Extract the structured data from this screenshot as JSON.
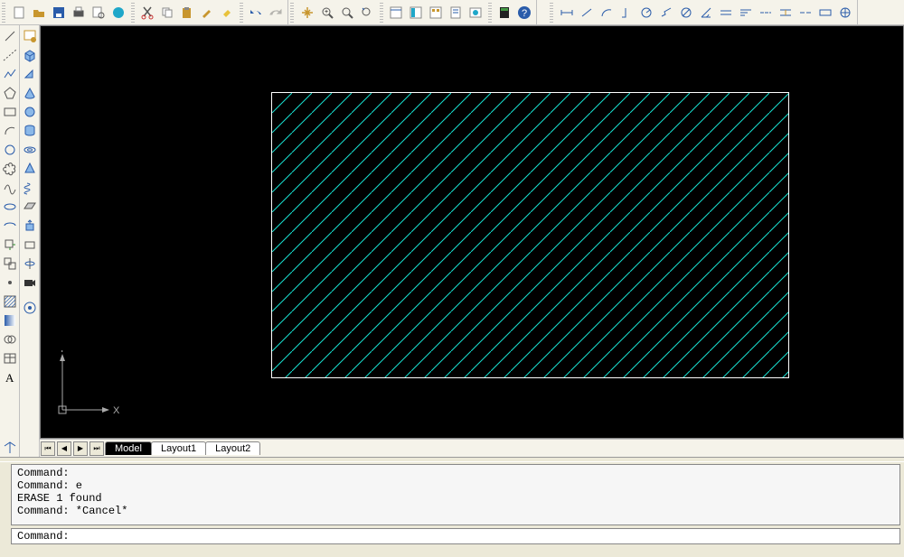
{
  "toolbar": {
    "group1": [
      "new",
      "open",
      "save",
      "print",
      "print-preview",
      "publish",
      "cut",
      "copy",
      "paste",
      "match",
      "paint",
      "undo",
      "redo"
    ],
    "group2": [
      "pan",
      "zoom-realtime",
      "zoom-window",
      "zoom-previous",
      "properties",
      "design-center",
      "tool-palettes",
      "sheet-set",
      "markup",
      "calc",
      "help"
    ],
    "group3": [
      "dim-linear",
      "dim-aligned",
      "dim-arc",
      "dim-ordinate",
      "dim-radius",
      "dim-jogged",
      "dim-diameter",
      "dim-angular",
      "dim-quick",
      "dim-baseline",
      "dim-continue",
      "dim-space",
      "dim-break",
      "dim-tolerance",
      "dim-center"
    ]
  },
  "left_tools_a": [
    "line",
    "construction-line",
    "polyline",
    "polygon",
    "rectangle",
    "arc",
    "circle",
    "revision-cloud",
    "spline",
    "ellipse",
    "ellipse-arc",
    "insert-block",
    "make-block",
    "point",
    "hatch",
    "gradient",
    "region",
    "table",
    "text"
  ],
  "left_tools_b": [
    "workspace-icon",
    "box",
    "wedge",
    "cone",
    "sphere",
    "cylinder",
    "torus",
    "pyramid",
    "helix",
    "planar-surface",
    "extrude",
    "revolve",
    "camera"
  ],
  "tabs": {
    "nav": [
      "⏮",
      "◀",
      "▶",
      "⏭"
    ],
    "active": "Model",
    "items": [
      "Model",
      "Layout1",
      "Layout2"
    ]
  },
  "command_lines": [
    "Command:",
    "Command: e",
    "ERASE 1 found",
    "Command: *Cancel*"
  ],
  "command_prompt": "Command:",
  "ucs": {
    "y": "Y",
    "x": "X"
  },
  "colors": {
    "hatch": "#18e0d0",
    "rect_border": "#ffffff"
  }
}
